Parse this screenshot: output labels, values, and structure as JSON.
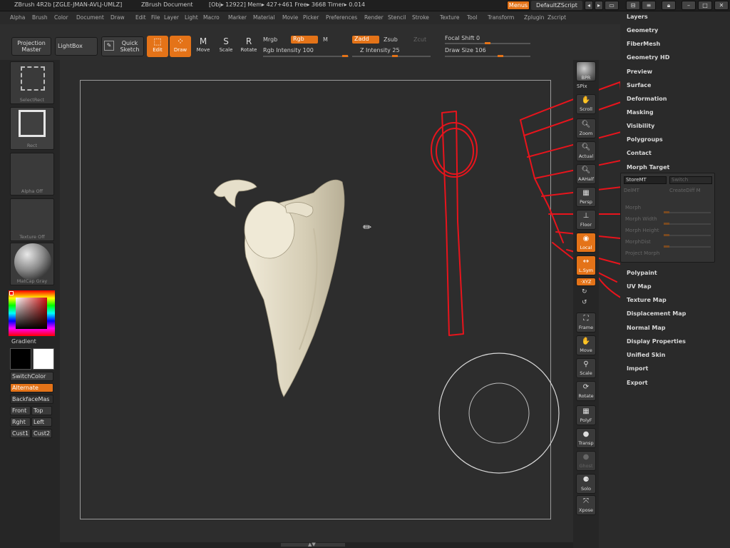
{
  "titlebar": {
    "app_title": "ZBrush 4R2b [ZGLE-JMAN-AVLJ-UMLZ]",
    "document": "ZBrush Document",
    "stats": "[Obj▸ 12922] Mem▸ 427+461  Free▸ 3668  Timer▸ 0.014",
    "menus_label": "Menus",
    "script_label": "DefaultZScript"
  },
  "menubar": {
    "items": [
      "Alpha",
      "Brush",
      "Color",
      "Document",
      "Draw",
      "Edit",
      "File",
      "Layer",
      "Light",
      "Macro",
      "Marker",
      "Material",
      "Movie",
      "Picker",
      "Preferences",
      "Render",
      "Stencil",
      "Stroke",
      "Texture",
      "Tool",
      "Transform",
      "Zplugin",
      "Zscript"
    ]
  },
  "toolbar": {
    "projection_master": "Projection Master",
    "lightbox": "LightBox",
    "quick_sketch": "Quick Sketch",
    "edit": "Edit",
    "draw": "Draw",
    "move": "Move",
    "scale": "Scale",
    "rotate": "Rotate",
    "mrgb": "Mrgb",
    "rgb": "Rgb",
    "m": "M",
    "zadd": "Zadd",
    "zsub": "Zsub",
    "zcut": "Zcut",
    "rgb_intensity_label": "Rgb Intensity 100",
    "z_intensity_label": "Z Intensity 25",
    "focal_shift_label": "Focal Shift 0",
    "draw_size_label": "Draw Size 106",
    "rgb_intensity": 100,
    "z_intensity": 25,
    "focal_shift": 0,
    "draw_size": 106
  },
  "leftshelf": {
    "select_rect": "SelectRect",
    "rect": "Rect",
    "alpha_off": "Alpha  Off",
    "texture_off": "Texture  Off",
    "matcap": "MatCap  Gray",
    "gradient": "Gradient",
    "switch_color": "SwitchColor",
    "alternate": "Alternate",
    "backface": "BackfaceMas",
    "front": "Front",
    "top": "Top",
    "right": "Rght",
    "left": "Left",
    "cust1": "Cust1",
    "cust2": "Cust2"
  },
  "rightshelf": {
    "bpr": "BPR",
    "spix": "SPix",
    "scroll": "Scroll",
    "zoom": "Zoom",
    "actual": "Actual",
    "aahalf": "AAHalf",
    "persp": "Persp",
    "floor": "Floor",
    "local": "Local",
    "lsym": "L.Sym",
    "xyz": "·XYZ",
    "frame": "Frame",
    "move": "Move",
    "scale": "Scale",
    "rotate": "Rotate",
    "polyf": "PolyF",
    "transp": "Transp",
    "ghost": "Ghost",
    "solo": "Solo",
    "xpose": "Xpose"
  },
  "palette": {
    "items_top": [
      "Layers",
      "Geometry",
      "FiberMesh",
      "Geometry HD",
      "Preview",
      "Surface",
      "Deformation",
      "Masking",
      "Visibility",
      "Polygroups",
      "Contact",
      "Morph Target"
    ],
    "items_bottom": [
      "Polypaint",
      "UV Map",
      "Texture Map",
      "Displacement Map",
      "Normal Map",
      "Display Properties",
      "Unified Skin",
      "Import",
      "Export"
    ],
    "morph": {
      "store_mt": "StoreMT",
      "switch": "Switch",
      "delete": "DelMT",
      "create_diff": "CreateDiff M",
      "morph": "Morph",
      "morph_width": "Morph Width",
      "morph_height": "Morph Height",
      "morph_dist": "MorphDist",
      "project_morph": "Project Morph"
    }
  },
  "colors": {
    "accent": "#e47318",
    "sketch": "#e8141c",
    "bone": "#d9d2bd"
  }
}
